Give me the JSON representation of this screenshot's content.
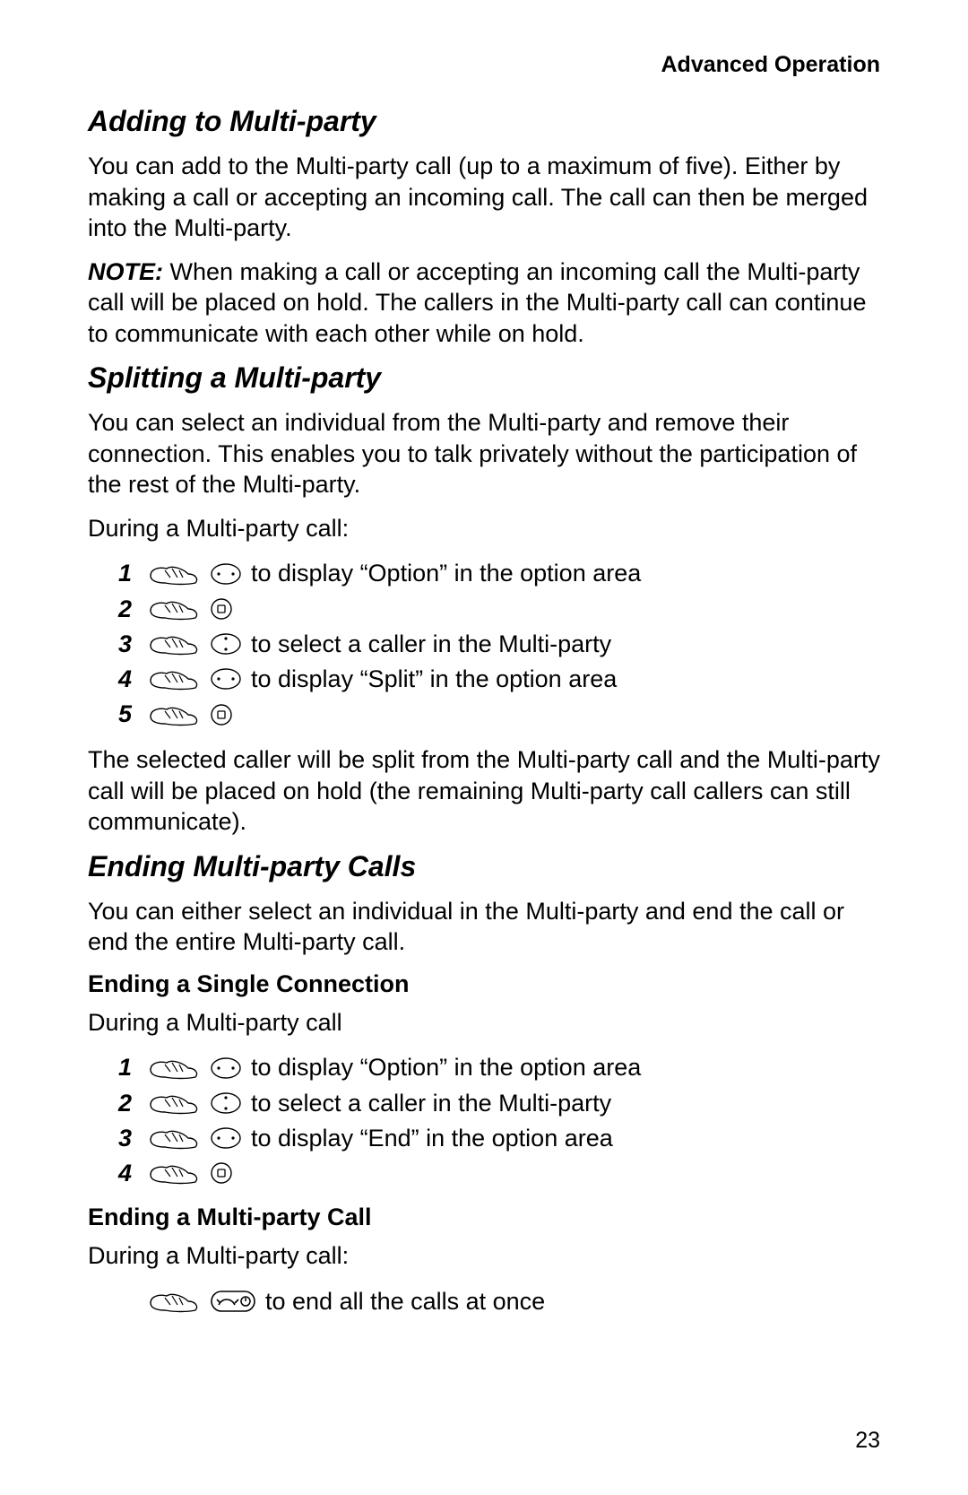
{
  "header": {
    "section_label": "Advanced Operation"
  },
  "page_number": "23",
  "sections": {
    "adding": {
      "title": "Adding to Multi-party",
      "p1": "You can add to the Multi-party call (up to a maximum of five). Either by making a call or accepting an incoming call. The call can then be merged into the Multi-party.",
      "note_label": "NOTE:",
      "note_body": " When making a call or accepting an incoming call the Multi-party call will be placed on hold. The callers in the Multi-party call can continue to communicate with each other while on hold."
    },
    "splitting": {
      "title": "Splitting a Multi-party",
      "p1": "You can select an individual from the Multi-party and remove their connection. This enables you to talk privately without the participation of the rest of the Multi-party.",
      "lead": "During a Multi-party call:",
      "steps": [
        {
          "num": "1",
          "icons": [
            "hand",
            "nav-horizontal"
          ],
          "text": " to display “Option” in the option area"
        },
        {
          "num": "2",
          "icons": [
            "hand",
            "select"
          ],
          "text": ""
        },
        {
          "num": "3",
          "icons": [
            "hand",
            "nav-vertical"
          ],
          "text": " to select a caller in the Multi-party"
        },
        {
          "num": "4",
          "icons": [
            "hand",
            "nav-horizontal"
          ],
          "text": " to display “Split” in the option area"
        },
        {
          "num": "5",
          "icons": [
            "hand",
            "select"
          ],
          "text": ""
        }
      ],
      "p_after": "The selected caller will be split from the Multi-party call and the Multi-party call will be placed on hold (the remaining Multi-party call callers can still communicate)."
    },
    "ending": {
      "title": "Ending Multi-party Calls",
      "p1": "You can either select an individual in the Multi-party and end the call or end the entire Multi-party call.",
      "sub1": {
        "title": "Ending a Single Connection",
        "lead": "During a Multi-party call",
        "steps": [
          {
            "num": "1",
            "icons": [
              "hand",
              "nav-horizontal"
            ],
            "text": " to display “Option” in the option area"
          },
          {
            "num": "2",
            "icons": [
              "hand",
              "nav-vertical"
            ],
            "text": " to select a caller in the Multi-party"
          },
          {
            "num": "3",
            "icons": [
              "hand",
              "nav-horizontal"
            ],
            "text": " to display “End” in the option area"
          },
          {
            "num": "4",
            "icons": [
              "hand",
              "select"
            ],
            "text": ""
          }
        ]
      },
      "sub2": {
        "title": "Ending a Multi-party Call",
        "lead": "During a Multi-party call:",
        "steps": [
          {
            "num": "",
            "icons": [
              "hand",
              "end-call"
            ],
            "text": " to end all the calls at once"
          }
        ]
      }
    }
  }
}
